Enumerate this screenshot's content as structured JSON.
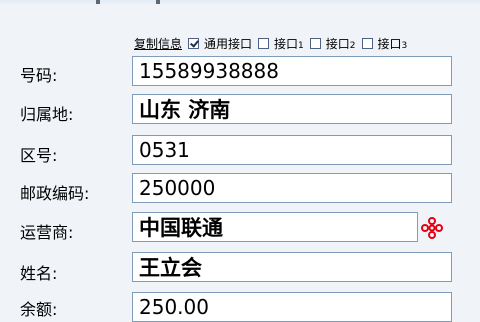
{
  "options": {
    "copy_label": "复制信息",
    "checkboxes": [
      {
        "label": "通用接口",
        "checked": true
      },
      {
        "label": "接口",
        "suffix": "1",
        "checked": false
      },
      {
        "label": "接口",
        "suffix": "2",
        "checked": false
      },
      {
        "label": "接口",
        "suffix": "3",
        "checked": false
      }
    ]
  },
  "fields": {
    "phone": {
      "label": "号码:",
      "value": "15589938888"
    },
    "region": {
      "label": "归属地:",
      "value": "山东 济南"
    },
    "areacode": {
      "label": "区号:",
      "value": "0531"
    },
    "postcode": {
      "label": "邮政编码:",
      "value": "250000"
    },
    "carrier": {
      "label": "运营商:",
      "value": "中国联通"
    },
    "name": {
      "label": "姓名:",
      "value": "王立会"
    },
    "extra": {
      "label": "余额:",
      "value": "250.00"
    }
  },
  "carrier_logo": {
    "icon": "china-unicom-logo-icon",
    "color": "#e60012"
  }
}
